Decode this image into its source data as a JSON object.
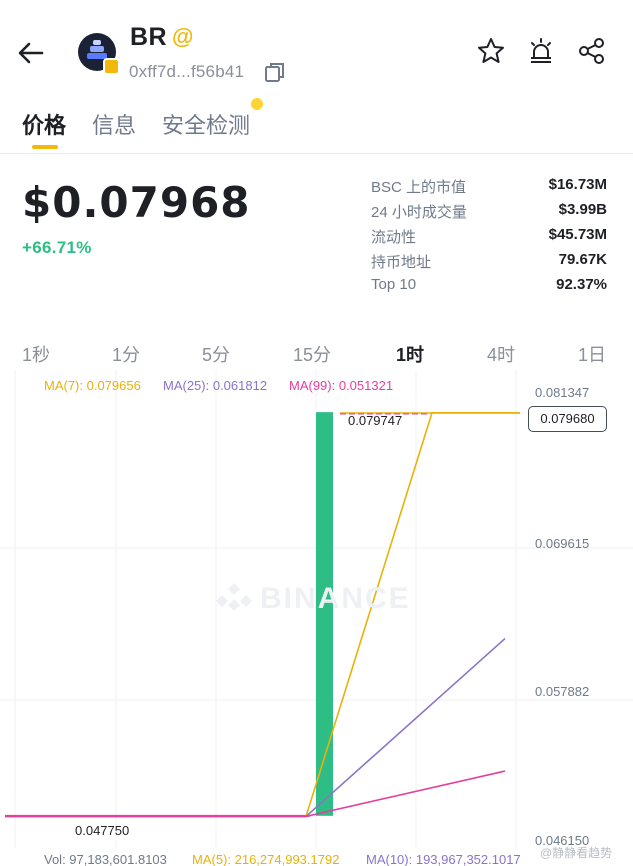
{
  "header": {
    "back_icon": "arrow-left-icon",
    "token_symbol": "BR",
    "at_badge": "@",
    "address": "0xff7d...f56b41",
    "icons": [
      "star-icon",
      "alert-siren-icon",
      "share-icon"
    ]
  },
  "tabs": [
    {
      "label": "价格",
      "active": true
    },
    {
      "label": "信息",
      "active": false
    },
    {
      "label": "安全检测",
      "active": false
    }
  ],
  "price": {
    "value": "$0.07968",
    "change": "+66.71%"
  },
  "stats": [
    {
      "label": "BSC 上的市值",
      "value": "$16.73M"
    },
    {
      "label": "24 小时成交量",
      "value": "$3.99B"
    },
    {
      "label": "流动性",
      "value": "$45.73M"
    },
    {
      "label": "持币地址",
      "value": "79.67K"
    },
    {
      "label": "Top 10",
      "value": "92.37%"
    }
  ],
  "intervals": [
    {
      "label": "1秒",
      "active": false
    },
    {
      "label": "1分",
      "active": false
    },
    {
      "label": "5分",
      "active": false
    },
    {
      "label": "15分",
      "active": false
    },
    {
      "label": "1时",
      "active": true
    },
    {
      "label": "4时",
      "active": false
    },
    {
      "label": "1日",
      "active": false
    }
  ],
  "chart": {
    "ma_legend": [
      {
        "text": "MA(7): 0.079656",
        "color": "#e8b10b"
      },
      {
        "text": "MA(25): 0.061812",
        "color": "#8a73c9"
      },
      {
        "text": "MA(99): 0.051321",
        "color": "#e2409f"
      }
    ],
    "y_labels": [
      "0.081347",
      "0.069615",
      "0.057882",
      "0.046150"
    ],
    "current_price_tag": "0.079680",
    "peak_label": "0.079747",
    "low_label": "0.047750",
    "watermark": "BINANCE",
    "volume_legend": [
      {
        "text": "Vol: 97,183,601.8103",
        "color": "#707a8a"
      },
      {
        "text": "MA(5): 216,274,993.1792",
        "color": "#e8b10b"
      },
      {
        "text": "MA(10): 193,967,352.1017",
        "color": "#8a73c9"
      }
    ],
    "source_watermark": "@静静看趋势",
    "up_color": "#2ebd85"
  },
  "chart_data": {
    "type": "line",
    "series": [
      {
        "name": "MA(7)",
        "values": [
          0.0477,
          0.0477,
          0.0477,
          0.0477,
          0.0477,
          0.0797,
          0.0797
        ]
      },
      {
        "name": "MA(25)",
        "values": [
          0.0477,
          0.0477,
          0.0477,
          0.0477,
          0.0477,
          0.0618
        ]
      },
      {
        "name": "MA(99)",
        "values": [
          0.0477,
          0.0477,
          0.0477,
          0.0477,
          0.0477,
          0.0513
        ]
      }
    ],
    "candles": [
      {
        "open": 0.04775,
        "close": 0.07975,
        "high": 0.07975,
        "low": 0.04775
      }
    ],
    "ylim": [
      0.04615,
      0.081347
    ],
    "yticks": [
      0.081347,
      0.069615,
      0.057882,
      0.04615
    ],
    "grid": true
  }
}
